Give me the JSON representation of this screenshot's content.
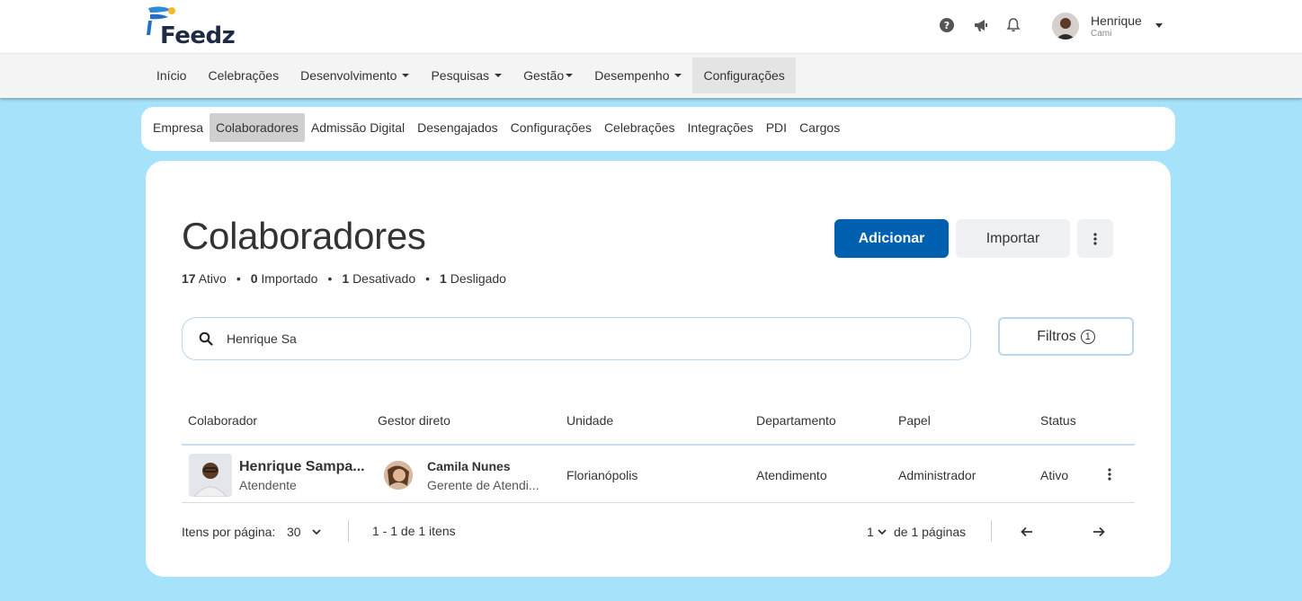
{
  "app": {
    "logo_text": "Feedz",
    "icons": [
      "help-icon",
      "megaphone-icon",
      "bell-icon"
    ],
    "user": {
      "name": "Henrique",
      "company": "Cami"
    }
  },
  "main_nav": [
    {
      "label": "Início",
      "dropdown": false
    },
    {
      "label": "Celebrações",
      "dropdown": false
    },
    {
      "label": "Desenvolvimento",
      "dropdown": true
    },
    {
      "label": "Pesquisas",
      "dropdown": true
    },
    {
      "label": "Gestão",
      "dropdown": true
    },
    {
      "label": "Desempenho",
      "dropdown": true
    },
    {
      "label": "Configurações",
      "dropdown": false,
      "active": true
    }
  ],
  "sub_nav": [
    {
      "label": "Empresa"
    },
    {
      "label": "Colaboradores",
      "active": true
    },
    {
      "label": "Admissão Digital"
    },
    {
      "label": "Desengajados"
    },
    {
      "label": "Configurações"
    },
    {
      "label": "Celebrações"
    },
    {
      "label": "Integrações"
    },
    {
      "label": "PDI"
    },
    {
      "label": "Cargos"
    }
  ],
  "page": {
    "title": "Colaboradores",
    "add_label": "Adicionar",
    "import_label": "Importar",
    "stats": [
      {
        "count": "17",
        "label": "Ativo"
      },
      {
        "count": "0",
        "label": "Importado"
      },
      {
        "count": "1",
        "label": "Desativado"
      },
      {
        "count": "1",
        "label": "Desligado"
      }
    ],
    "search": {
      "value": "Henrique Sa",
      "placeholder": ""
    },
    "filters_label": "Filtros",
    "filters_count": "1"
  },
  "table": {
    "columns": [
      "Colaborador",
      "Gestor direto",
      "Unidade",
      "Departamento",
      "Papel",
      "Status"
    ],
    "rows": [
      {
        "name": "Henrique Sampa...",
        "role": "Atendente",
        "manager_name": "Camila Nunes",
        "manager_role": "Gerente de Atendi...",
        "unit": "Florianópolis",
        "department": "Atendimento",
        "papel": "Administrador",
        "status": "Ativo"
      }
    ]
  },
  "pagination": {
    "per_page_label": "Itens por página:",
    "per_page": "30",
    "range": "1 - 1 de 1 itens",
    "current_page": "1",
    "pages_label": "de 1 páginas"
  },
  "colors": {
    "background": "#a6e2fa",
    "primary": "#0060b0",
    "secondary_btn": "#eef0f4"
  }
}
